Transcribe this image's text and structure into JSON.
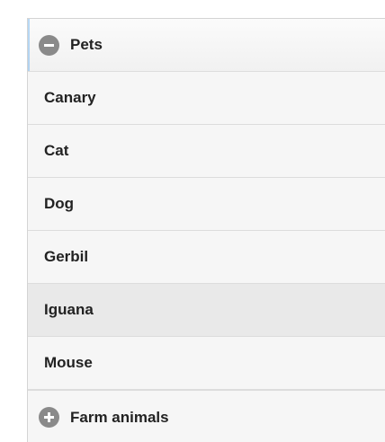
{
  "groups": [
    {
      "title": "Pets",
      "state": "expanded",
      "icon": "minus-icon",
      "items": [
        {
          "label": "Canary"
        },
        {
          "label": "Cat"
        },
        {
          "label": "Dog"
        },
        {
          "label": "Gerbil"
        },
        {
          "label": "Iguana",
          "highlighted": true
        },
        {
          "label": "Mouse"
        }
      ]
    },
    {
      "title": "Farm animals",
      "state": "collapsed",
      "icon": "plus-icon"
    }
  ],
  "colors": {
    "background": "#f6f6f6",
    "highlight": "#e9e9e9",
    "icon": "#8a8a8a",
    "focus_glow": "#3898ec",
    "text": "#222222"
  }
}
